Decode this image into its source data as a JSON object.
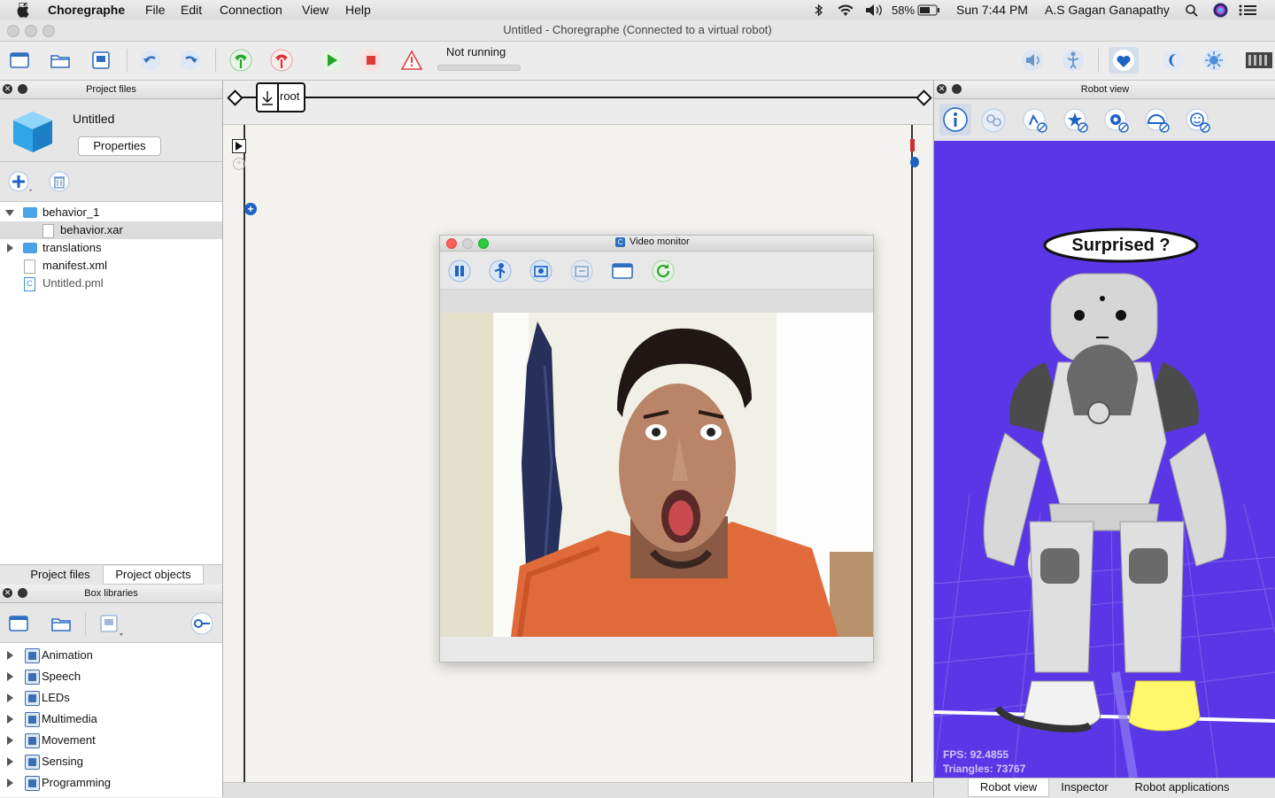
{
  "menubar": {
    "apple": "",
    "app_name": "Choregraphe",
    "items": [
      "File",
      "Edit",
      "Connection",
      "View",
      "Help"
    ],
    "battery": "58%",
    "clock": "Sun 7:44 PM",
    "user": "A.S Gagan Ganapathy"
  },
  "window": {
    "title": "Untitled - Choregraphe (Connected to a virtual robot)"
  },
  "toolbar": {
    "status": "Not running"
  },
  "project_panel": {
    "header": "Project files",
    "project_name": "Untitled",
    "properties_label": "Properties",
    "tree": [
      {
        "label": "behavior_1",
        "type": "folder",
        "expanded": true
      },
      {
        "label": "behavior.xar",
        "type": "file",
        "selected": true
      },
      {
        "label": "translations",
        "type": "folder",
        "expanded": false
      },
      {
        "label": "manifest.xml",
        "type": "file"
      },
      {
        "label": "Untitled.pml",
        "type": "pml"
      }
    ],
    "tabs": [
      "Project files",
      "Project objects"
    ]
  },
  "box_libraries": {
    "header": "Box libraries",
    "items": [
      "Animation",
      "Speech",
      "LEDs",
      "Multimedia",
      "Movement",
      "Sensing",
      "Programming"
    ]
  },
  "flow": {
    "root_label": "root"
  },
  "video_monitor": {
    "title": "Video monitor"
  },
  "robot_view": {
    "header": "Robot view",
    "speech_bubble": "Surprised ?",
    "fps": "FPS: 92.4855",
    "triangles": "Triangles: 73767",
    "tabs": [
      "Robot view",
      "Inspector",
      "Robot applications"
    ],
    "floor_color": "#5a37e6"
  }
}
